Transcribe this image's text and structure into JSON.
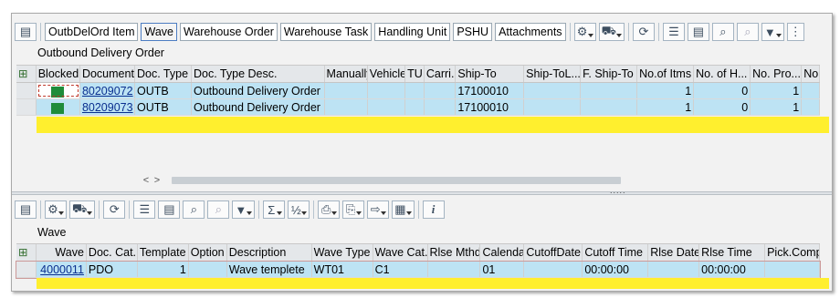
{
  "top_toolbar": {
    "tabs": [
      {
        "label": "OutbDelOrd Item",
        "active": false
      },
      {
        "label": "Wave",
        "active": true
      },
      {
        "label": "Warehouse Order",
        "active": false
      },
      {
        "label": "Warehouse Task",
        "active": false
      },
      {
        "label": "Handling Unit",
        "active": false
      },
      {
        "label": "PSHU",
        "active": false
      },
      {
        "label": "Attachments",
        "active": false
      }
    ]
  },
  "top_panel": {
    "title": "Outbound Delivery Order",
    "columns": [
      "Blocked",
      "Document",
      "Doc. Type",
      "Doc. Type Desc.",
      "Manually",
      "Vehicle",
      "TU",
      "Carri...",
      "Ship-To",
      "Ship-ToL...",
      "F. Ship-To",
      "No.of Itms",
      "No. of H...",
      "No. Pro...",
      "No"
    ],
    "rows": [
      {
        "blocked": "green",
        "document": "80209072",
        "doc_type": "OUTB",
        "doc_type_desc": "Outbound Delivery Order",
        "manually": "",
        "vehicle": "",
        "tu": "",
        "carrier": "",
        "ship_to": "17100010",
        "ship_to_loc": "",
        "f_ship_to": "",
        "no_items": "1",
        "no_hu": "0",
        "no_pro": "1",
        "no": ""
      },
      {
        "blocked": "green",
        "document": "80209073",
        "doc_type": "OUTB",
        "doc_type_desc": "Outbound Delivery Order",
        "manually": "",
        "vehicle": "",
        "tu": "",
        "carrier": "",
        "ship_to": "17100010",
        "ship_to_loc": "",
        "f_ship_to": "",
        "no_items": "1",
        "no_hu": "0",
        "no_pro": "1",
        "no": ""
      }
    ]
  },
  "bottom_panel": {
    "title": "Wave",
    "columns": [
      "Wave",
      "Doc. Cat.",
      "Template",
      "Option",
      "Description",
      "Wave Type",
      "Wave Cat.",
      "Rlse Mthd",
      "Calendar",
      "CutoffDate",
      "Cutoff Time",
      "Rlse Date",
      "Rlse Time",
      "Pick.Compl"
    ],
    "rows": [
      {
        "wave": "4000011",
        "doc_cat": "PDO",
        "template": "1",
        "option": "",
        "description": "Wave templete",
        "wave_type": "WT01",
        "wave_cat": "C1",
        "rlse_mthd": "",
        "calendar": "01",
        "cutoff_date": "",
        "cutoff_time": "00:00:00",
        "rlse_date": "",
        "rlse_time": "00:00:00",
        "pick_compl": ""
      }
    ]
  },
  "colors": {
    "selection": "#bde3f4",
    "highlight_row": "#ffef2e",
    "status_green": "#1f8c3a",
    "link": "#0a2f8f"
  },
  "scroll": {
    "left_arrow": "<",
    "right_arrow": ">"
  },
  "splitter_grip": "....."
}
